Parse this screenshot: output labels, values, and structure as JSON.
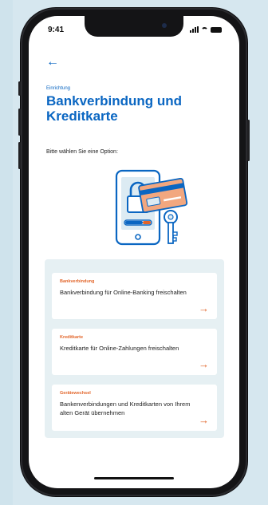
{
  "status_bar": {
    "time": "9:41"
  },
  "navigation": {
    "back_icon": "←"
  },
  "header": {
    "eyebrow": "Einrichtung",
    "title": "Bankverbindung und Kreditkarte"
  },
  "prompt": "Bitte wählen Sie eine Option:",
  "illustration": {
    "icon": "phone-lock-card-key-illustration"
  },
  "options": [
    {
      "label": "Bankverbindung",
      "description": "Bankverbindung für Online-Banking freischalten",
      "arrow": "→"
    },
    {
      "label": "Kreditkarte",
      "description": "Kreditkarte für Online-Zahlungen freischalten",
      "arrow": "→"
    },
    {
      "label": "Gerätewechsel",
      "description": "Bankenverbindungen und Kreditkarten von Ihrem alten Gerät übernehmen",
      "arrow": "→"
    }
  ],
  "colors": {
    "brand_blue": "#0a66c2",
    "accent_orange": "#e2652a",
    "panel_background": "#e6f0f3",
    "page_background": "#d6e7ef"
  }
}
